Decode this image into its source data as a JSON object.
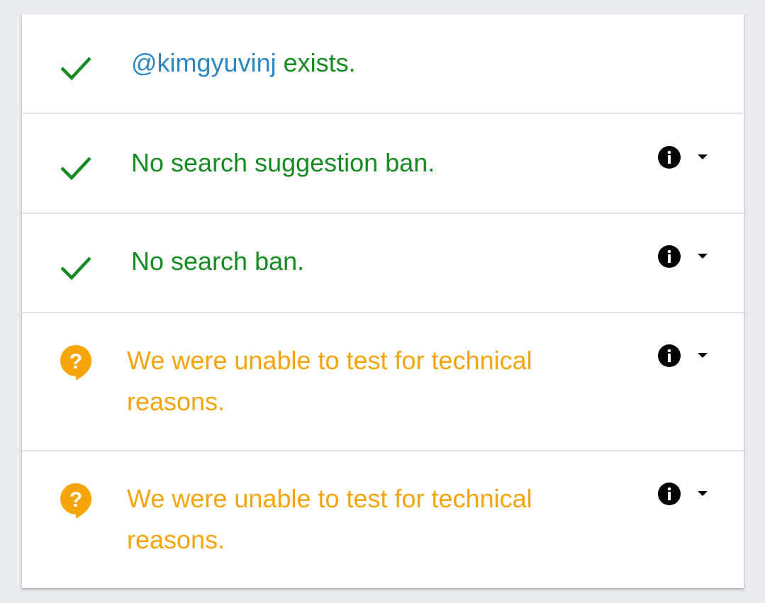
{
  "results": [
    {
      "status": "ok",
      "status_icon": "check-icon",
      "handle": "@kimgyuvinj",
      "text": " exists.",
      "has_details": false
    },
    {
      "status": "ok",
      "status_icon": "check-icon",
      "text": "No search suggestion ban.",
      "has_details": true,
      "detail_icons": [
        "info-icon",
        "caret-down-icon"
      ]
    },
    {
      "status": "ok",
      "status_icon": "check-icon",
      "text": "No search ban.",
      "has_details": true,
      "detail_icons": [
        "info-icon",
        "caret-down-icon"
      ]
    },
    {
      "status": "unknown",
      "status_icon": "question-bubble-icon",
      "text": "We were unable to test for technical reasons.",
      "has_details": true,
      "detail_icons": [
        "info-icon",
        "caret-down-icon"
      ]
    },
    {
      "status": "unknown",
      "status_icon": "question-bubble-icon",
      "text": "We were unable to test for technical reasons.",
      "has_details": true,
      "detail_icons": [
        "info-icon",
        "caret-down-icon"
      ]
    }
  ],
  "colors": {
    "ok": "#178a23",
    "unknown": "#f5a50a",
    "handle_link": "#2d87c4",
    "background": "#e9edf0",
    "card": "#ffffff",
    "divider": "#e1e4e7"
  }
}
